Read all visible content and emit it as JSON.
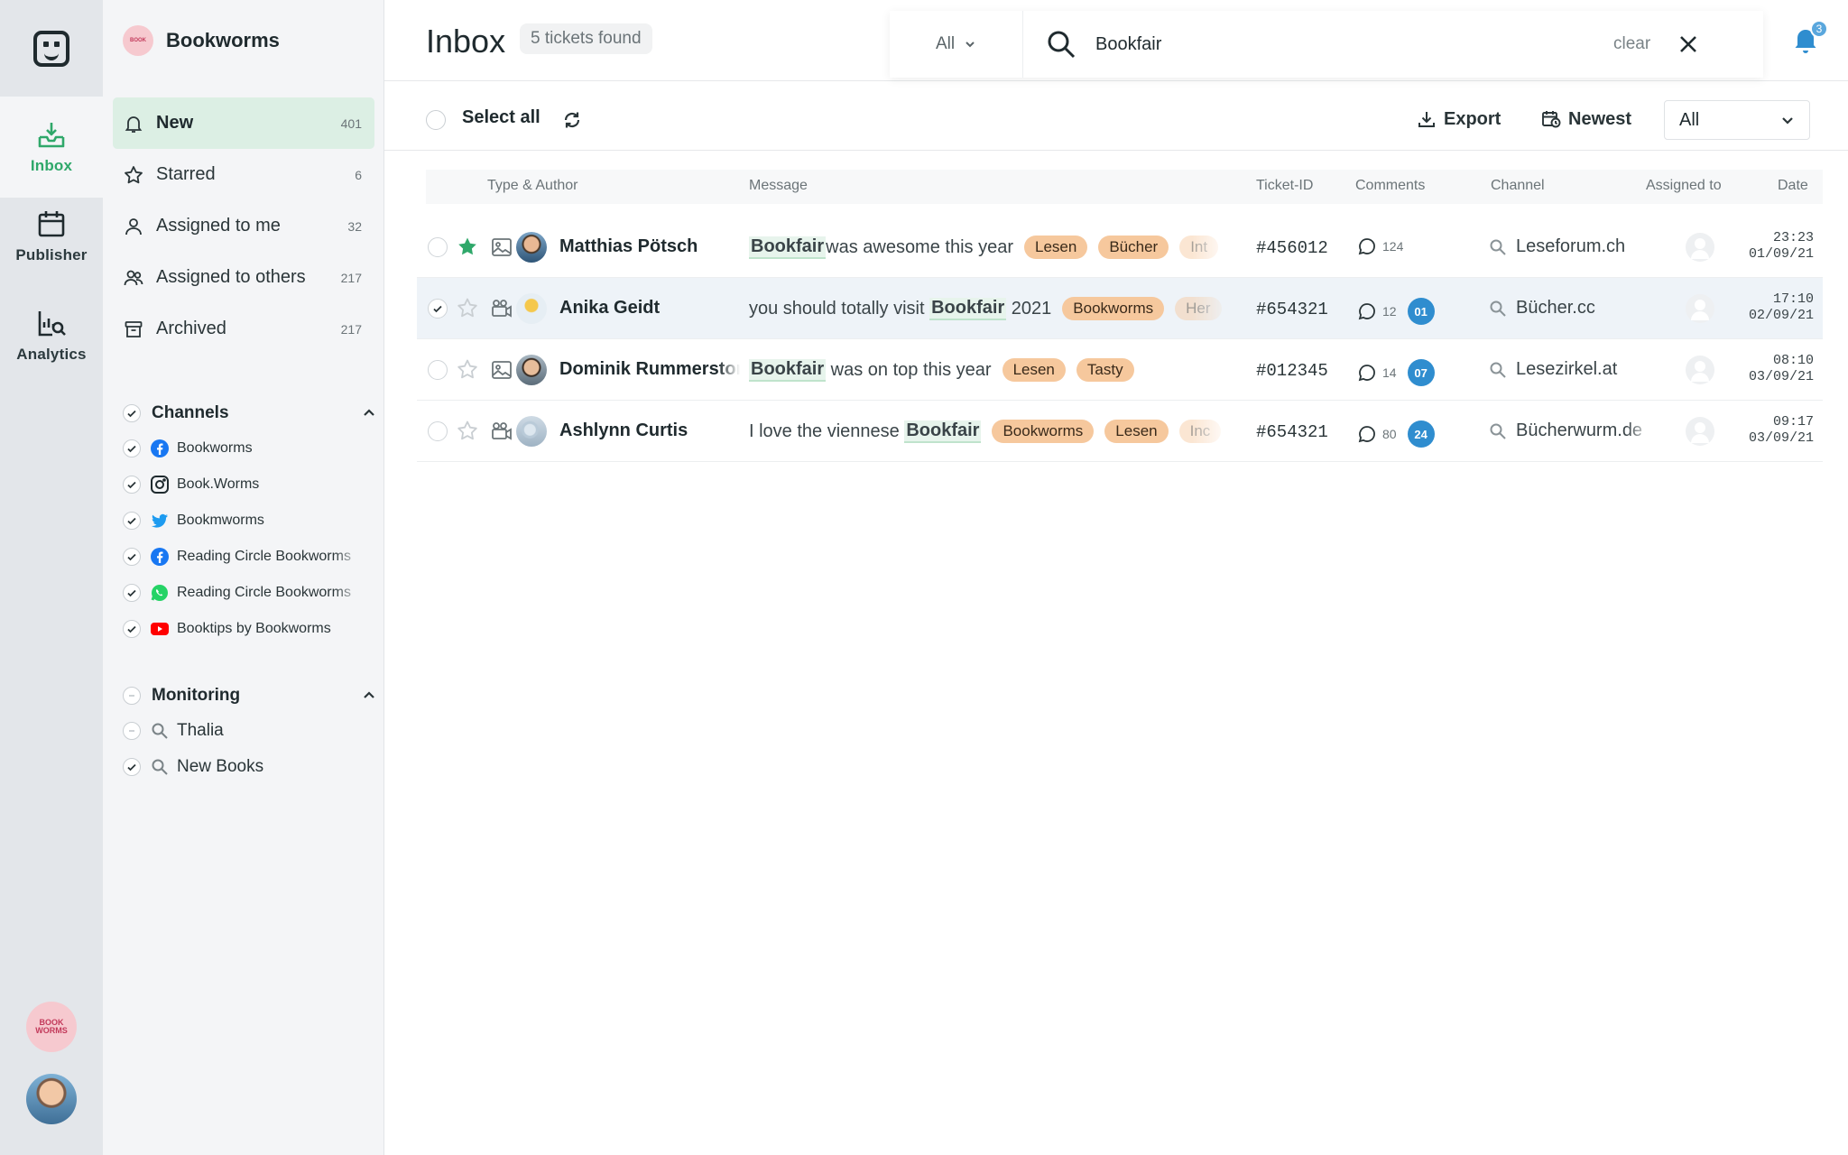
{
  "rail": {
    "items": [
      {
        "label": "Inbox",
        "icon": "inbox-icon"
      },
      {
        "label": "Publisher",
        "icon": "calendar-icon"
      },
      {
        "label": "Analytics",
        "icon": "analytics-icon"
      }
    ],
    "brand_badge": "BOOK WORMS"
  },
  "sidebar": {
    "brand": "Bookworms",
    "nav": [
      {
        "label": "New",
        "count": "401",
        "icon": "bell-icon"
      },
      {
        "label": "Starred",
        "count": "6",
        "icon": "star-icon"
      },
      {
        "label": "Assigned to me",
        "count": "32",
        "icon": "user-icon"
      },
      {
        "label": "Assigned to others",
        "count": "217",
        "icon": "users-icon"
      },
      {
        "label": "Archived",
        "count": "217",
        "icon": "archive-icon"
      }
    ],
    "channels_title": "Channels",
    "channels": [
      {
        "label": "Bookworms",
        "icon": "facebook-icon"
      },
      {
        "label": "Book.Worms",
        "icon": "instagram-icon"
      },
      {
        "label": "Bookmworms",
        "icon": "twitter-icon"
      },
      {
        "label": "Reading Circle Bookworms",
        "icon": "facebook-icon"
      },
      {
        "label": "Reading Circle Bookworms",
        "icon": "whatsapp-icon"
      },
      {
        "label": "Booktips by Bookworms",
        "icon": "youtube-icon"
      }
    ],
    "monitoring_title": "Monitoring",
    "monitoring": [
      {
        "label": "Thalia",
        "checked": false
      },
      {
        "label": "New Books",
        "checked": true
      }
    ]
  },
  "header": {
    "title": "Inbox",
    "found": "5 tickets found",
    "scope": "All",
    "search_value": "Bookfair",
    "clear_label": "clear",
    "notif_count": "3"
  },
  "toolbar": {
    "select_all": "Select all",
    "export": "Export",
    "sort": "Newest",
    "filter": "All"
  },
  "table": {
    "headers": {
      "type_author": "Type & Author",
      "message": "Message",
      "ticket_id": "Ticket-ID",
      "comments": "Comments",
      "channel": "Channel",
      "assigned": "Assigned to",
      "date": "Date"
    },
    "rows": [
      {
        "author": "Matthias Pötsch",
        "pre": "",
        "kw": "Bookfair",
        "post": " was awesome this year",
        "tags": [
          "Lesen",
          "Bücher",
          "Int"
        ],
        "ticket": "#456012",
        "comments": "124",
        "badge": "",
        "channel": "Leseforum.ch",
        "time": "23:23",
        "date": "01/09/21",
        "starred": true,
        "selected": false,
        "type": "image"
      },
      {
        "author": "Anika Geidt",
        "pre": "you should totally visit ",
        "kw": "Bookfair",
        "post": " 2021",
        "tags": [
          "Bookworms",
          "Her"
        ],
        "ticket": "#654321",
        "comments": "12",
        "badge": "01",
        "channel": "Bücher.cc",
        "time": "17:10",
        "date": "02/09/21",
        "starred": false,
        "selected": true,
        "type": "video"
      },
      {
        "author": "Dominik Rummerstorfer",
        "pre": "",
        "kw": "Bookfair",
        "post": " was on top this year",
        "tags": [
          "Lesen",
          "Tasty"
        ],
        "ticket": "#012345",
        "comments": "14",
        "badge": "07",
        "channel": "Lesezirkel.at",
        "time": "08:10",
        "date": "03/09/21",
        "starred": false,
        "selected": false,
        "type": "image"
      },
      {
        "author": "Ashlynn Curtis",
        "pre": "I love the viennese ",
        "kw": "Bookfair",
        "post": "",
        "tags": [
          "Bookworms",
          "Lesen",
          "Inc"
        ],
        "ticket": "#654321",
        "comments": "80",
        "badge": "24",
        "channel": "Bücherwurm.de",
        "time": "09:17",
        "date": "03/09/21",
        "starred": false,
        "selected": false,
        "type": "video"
      }
    ]
  },
  "colors": {
    "accent": "#2fa86a",
    "tag": "#f6c89d",
    "badge": "#2f8dcf"
  }
}
